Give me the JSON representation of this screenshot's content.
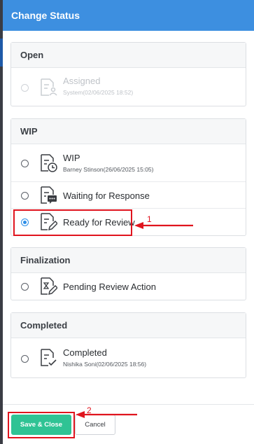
{
  "dialog": {
    "title": "Change Status"
  },
  "groups": [
    {
      "title": "Open",
      "options": [
        {
          "label": "Assigned",
          "meta": "System(02/06/2025 18:52)",
          "icon": "assign-user-icon",
          "disabled": true,
          "selected": false
        }
      ]
    },
    {
      "title": "WIP",
      "options": [
        {
          "label": "WIP",
          "meta": "Barney Stinson(26/06/2025 15:05)",
          "icon": "clock-document-icon",
          "disabled": false,
          "selected": false
        },
        {
          "label": "Waiting for Response",
          "meta": "",
          "icon": "chat-document-icon",
          "disabled": false,
          "selected": false
        },
        {
          "label": "Ready for Review",
          "meta": "",
          "icon": "edit-document-icon",
          "disabled": false,
          "selected": true
        }
      ]
    },
    {
      "title": "Finalization",
      "options": [
        {
          "label": "Pending Review Action",
          "meta": "",
          "icon": "hourglass-edit-document-icon",
          "disabled": false,
          "selected": false
        }
      ]
    },
    {
      "title": "Completed",
      "options": [
        {
          "label": "Completed",
          "meta": "Nishika Soni(02/06/2025 18:56)",
          "icon": "check-document-icon",
          "disabled": false,
          "selected": false
        }
      ]
    }
  ],
  "footer": {
    "save_label": "Save & Close",
    "cancel_label": "Cancel"
  },
  "annotations": {
    "marker_1": "1",
    "marker_2": "2"
  },
  "colors": {
    "header": "#3d8fe0",
    "save": "#2fc394",
    "annotation": "#e0141e",
    "radio_selected": "#2d8ee8"
  }
}
